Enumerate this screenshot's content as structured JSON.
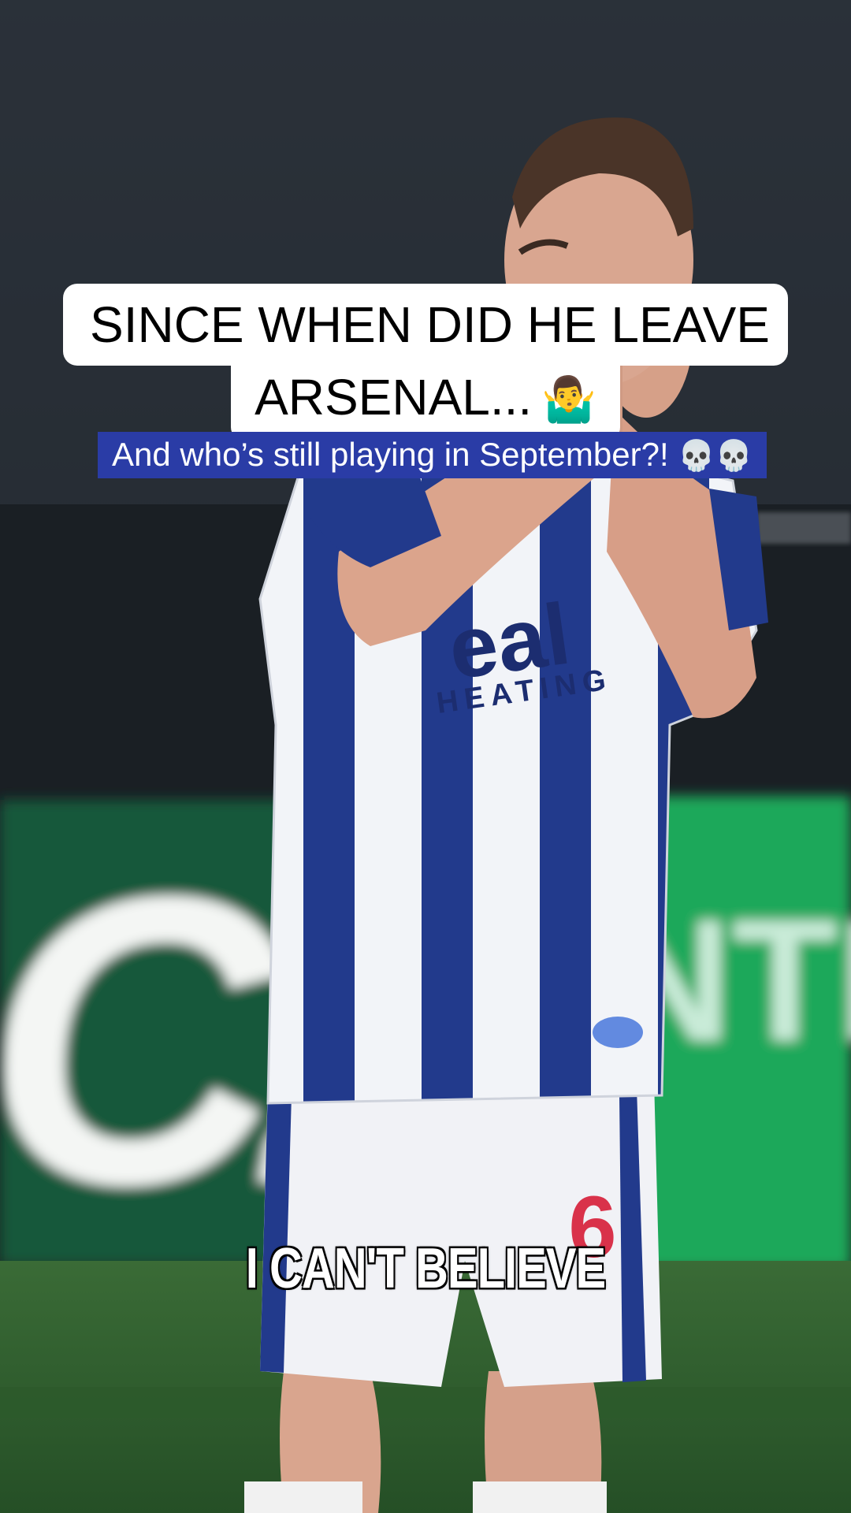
{
  "title": {
    "line1": "SINCE WHEN DID HE LEAVE",
    "line2": "ARSENAL...",
    "emoji": "🤷‍♂️"
  },
  "subtitle": {
    "text": "And who’s still playing in September?!",
    "emoji": "💀💀"
  },
  "caption": {
    "text": "I CAN'T BELIEVE"
  },
  "scene": {
    "shirt_sponsor": "eal",
    "shirt_sponsor_sub": "HEATING",
    "shirt_number": "6",
    "board_text_left": "C2",
    "board_text_right": "NTE",
    "colors": {
      "kit_blue": "#223a8c",
      "kit_white": "#f2f4f8",
      "board_green": "#1aa85a",
      "pitch": "#2f5e2e"
    }
  }
}
